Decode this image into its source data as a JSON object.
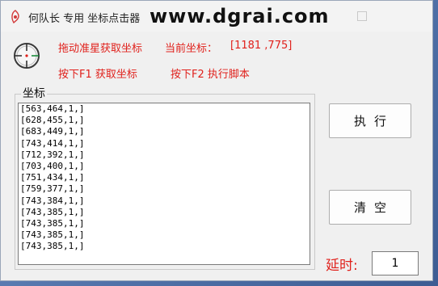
{
  "window": {
    "title": "何队长 专用  坐标点击器",
    "watermark": "www.dgrai.com"
  },
  "info": {
    "drag_hint": "拖动准星获取坐标",
    "current_label": "当前坐标：",
    "current_value": "[1181 ,775]",
    "f1_hint": "按下F1  获取坐标",
    "f2_hint": "按下F2   执行脚本"
  },
  "coords": {
    "group_label": "坐标",
    "items": [
      "[563,464,1,]",
      "[628,455,1,]",
      "[683,449,1,]",
      "[743,414,1,]",
      "[712,392,1,]",
      "[703,400,1,]",
      "[751,434,1,]",
      "[759,377,1,]",
      "[743,384,1,]",
      "[743,385,1,]",
      "[743,385,1,]",
      "[743,385,1,]",
      "[743,385,1,]"
    ]
  },
  "buttons": {
    "execute": "执行",
    "clear": "清空"
  },
  "delay": {
    "label": "延时:",
    "value": "1"
  },
  "colors": {
    "accent_red": "#e0201b",
    "window_bg": "#f0f0f0"
  }
}
